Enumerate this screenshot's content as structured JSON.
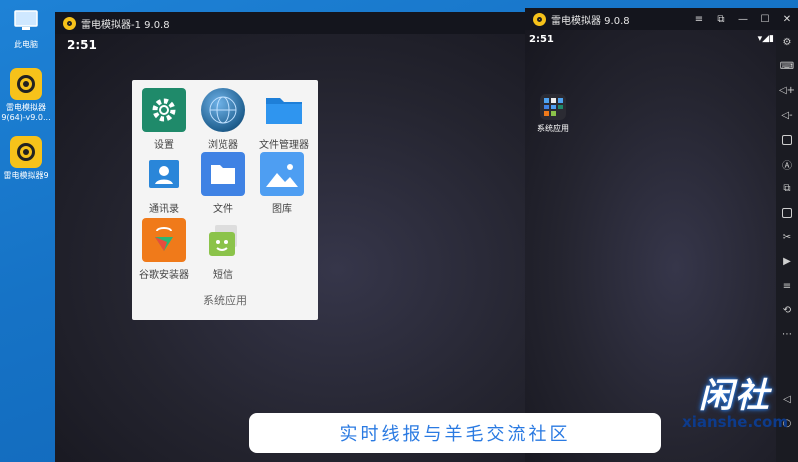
{
  "desktop": {
    "icons": [
      {
        "label": "此电脑"
      },
      {
        "label": "雷电模拟器",
        "sub": "9(64)-v9.0..."
      },
      {
        "label": "雷电模拟器9"
      }
    ]
  },
  "left_window": {
    "title": "雷电模拟器-1 9.0.8",
    "clock": "2:51",
    "folder": {
      "name": "系统应用",
      "apps": [
        "设置",
        "浏览器",
        "文件管理器",
        "通讯录",
        "文件",
        "图库",
        "谷歌安装器",
        "短信"
      ]
    }
  },
  "right_window": {
    "title": "雷电模拟器 9.0.8",
    "clock": "2:51",
    "home_icon_label": "系统应用",
    "controls": [
      "≡",
      "⧉",
      "—",
      "☐",
      "✕"
    ],
    "toolbar": [
      "gear-icon",
      "keyboard-icon",
      "volume-up-icon",
      "volume-down-icon",
      "screenshot-icon",
      "macro-icon",
      "multi-window-icon",
      "apk-icon",
      "cut-icon",
      "record-icon",
      "shake-icon",
      "rotate-icon",
      "more-icon",
      "back-icon",
      "home-icon"
    ]
  },
  "banner": {
    "text": "实时线报与羊毛交流社区"
  },
  "watermark": {
    "big": "闲社",
    "small": "xianshe.com"
  },
  "colors": {
    "accent": "#2a7ae2",
    "ld_yellow": "#f6c21a"
  }
}
